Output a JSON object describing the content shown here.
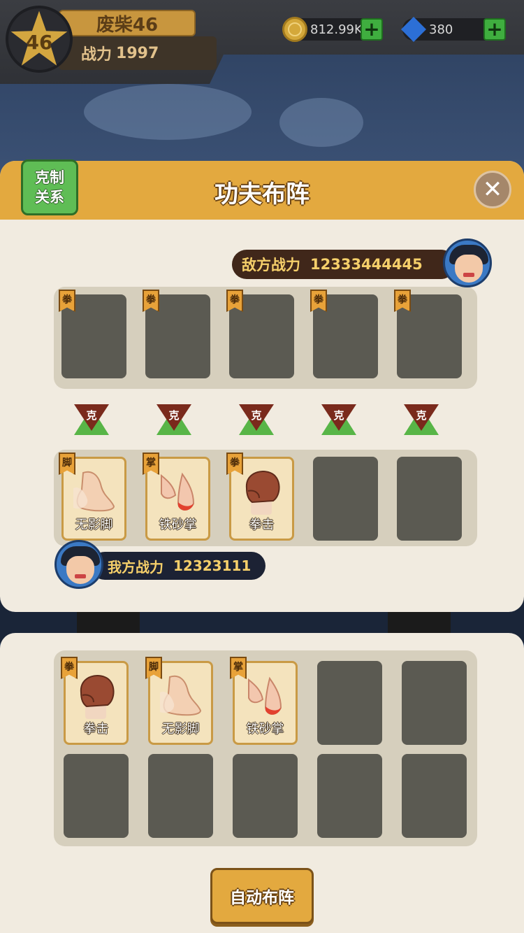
{
  "player": {
    "level": "46",
    "name": "废柴46",
    "power_label": "战力",
    "power_value": "1997"
  },
  "resources": {
    "gold": "812.99K",
    "gems": "380"
  },
  "panel": {
    "title": "功夫布阵",
    "relation_line1": "克制",
    "relation_line2": "关系"
  },
  "enemy": {
    "power_label": "敌方战力",
    "power_value": "12333444445",
    "slot_tags": [
      "拳",
      "拳",
      "拳",
      "拳",
      "拳"
    ]
  },
  "counters": [
    "克",
    "克",
    "克",
    "克",
    "克"
  ],
  "my_team": {
    "power_label": "我方战力",
    "power_value": "12323111",
    "slots": [
      {
        "tag": "脚",
        "name": "无影脚"
      },
      {
        "tag": "掌",
        "name": "铁砂掌"
      },
      {
        "tag": "拳",
        "name": "拳击"
      }
    ]
  },
  "inventory": [
    {
      "tag": "拳",
      "name": "拳击"
    },
    {
      "tag": "脚",
      "name": "无影脚"
    },
    {
      "tag": "掌",
      "name": "铁砂掌"
    }
  ],
  "actions": {
    "auto_arrange": "自动布阵"
  },
  "colors": {
    "accent": "#e3a93f",
    "panel": "#f1ebe0",
    "slot_empty": "#5b5a52",
    "counter_green": "#58b547",
    "counter_red": "#7a2a1c"
  }
}
